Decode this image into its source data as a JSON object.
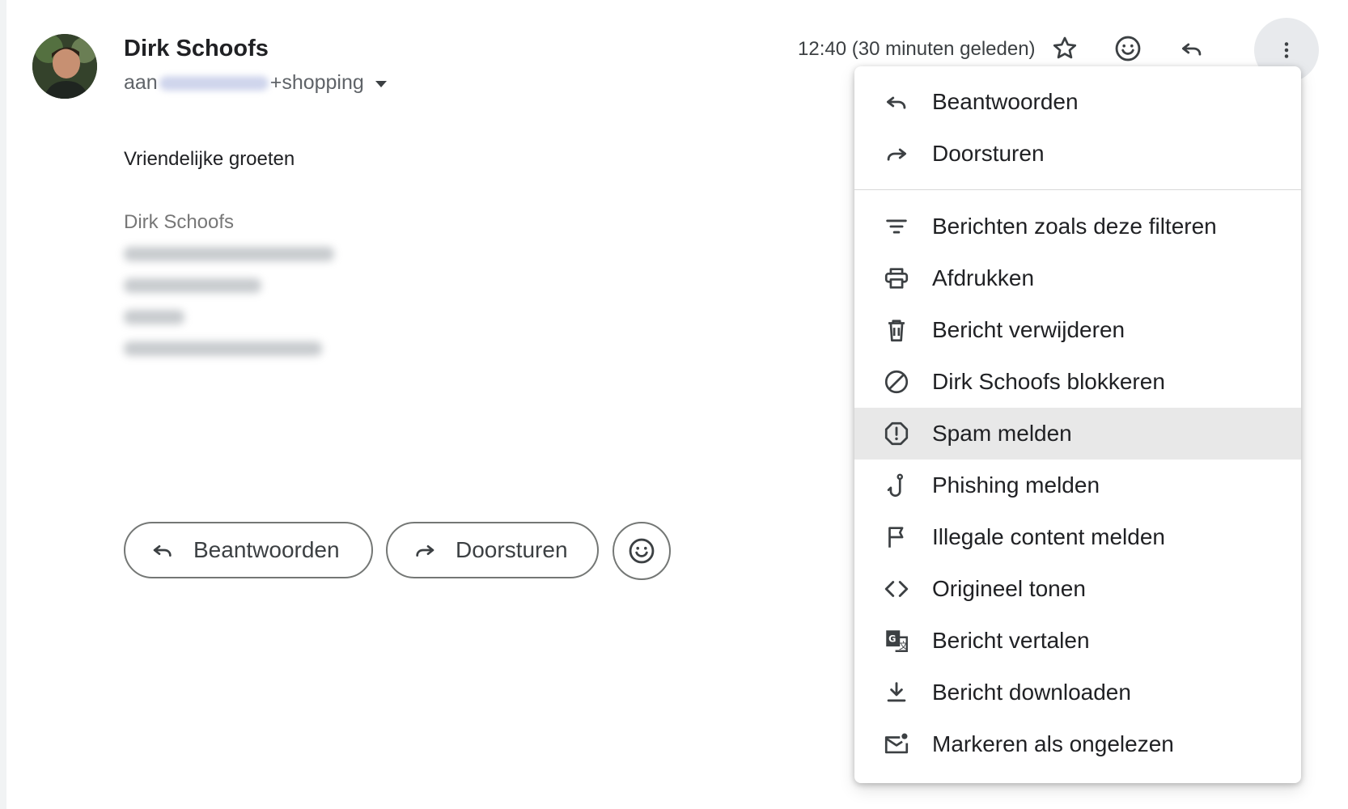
{
  "email": {
    "sender_name": "Dirk Schoofs",
    "to_prefix": "aan",
    "to_suffix": "+shopping",
    "time": "12:40 (30 minuten geleden)",
    "greeting": "Vriendelijke groeten",
    "signature_name": "Dirk Schoofs"
  },
  "header_icons": [
    "star-icon",
    "emoji-icon",
    "reply-icon",
    "more-vert-icon"
  ],
  "actions": {
    "reply_label": "Beantwoorden",
    "forward_label": "Doorsturen"
  },
  "menu": {
    "items": [
      {
        "label": "Beantwoorden",
        "icon": "reply-icon"
      },
      {
        "label": "Doorsturen",
        "icon": "forward-icon"
      },
      {
        "label": "Berichten zoals deze filteren",
        "icon": "filter-icon"
      },
      {
        "label": "Afdrukken",
        "icon": "print-icon"
      },
      {
        "label": "Bericht verwijderen",
        "icon": "trash-icon"
      },
      {
        "label": "Dirk Schoofs blokkeren",
        "icon": "block-icon"
      },
      {
        "label": "Spam melden",
        "icon": "spam-icon",
        "highlighted": true
      },
      {
        "label": "Phishing melden",
        "icon": "phishing-hook-icon"
      },
      {
        "label": "Illegale content melden",
        "icon": "flag-icon"
      },
      {
        "label": "Origineel tonen",
        "icon": "code-icon"
      },
      {
        "label": "Bericht vertalen",
        "icon": "translate-icon"
      },
      {
        "label": "Bericht downloaden",
        "icon": "download-icon"
      },
      {
        "label": "Markeren als ongelezen",
        "icon": "mark-unread-icon"
      }
    ]
  }
}
